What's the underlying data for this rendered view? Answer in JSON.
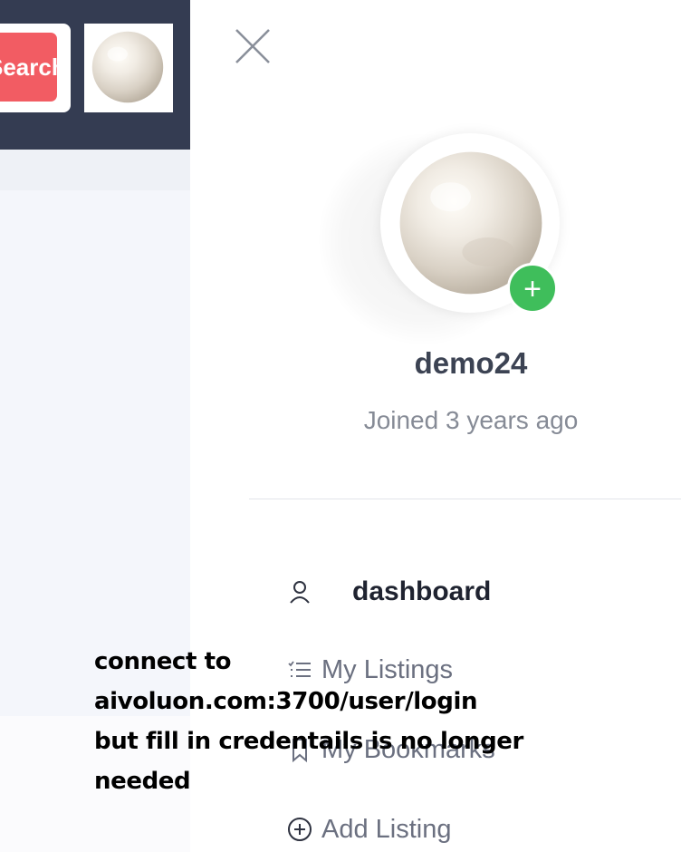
{
  "header": {
    "search_button_label": "Search"
  },
  "drawer": {
    "profile": {
      "username": "demo24",
      "joined": "Joined 3 years ago"
    },
    "menu": [
      {
        "label": "dashboard",
        "icon": "user-icon"
      },
      {
        "label": "My Listings",
        "icon": "list-icon"
      },
      {
        "label": "My Bookmarks",
        "icon": "bookmark-icon"
      },
      {
        "label": "Add Listing",
        "icon": "plus-circle-icon"
      }
    ]
  },
  "note": {
    "text": "connect to\naivoluon.com:3700/user/login\nbut fill in credentails is no longer\nneeded"
  },
  "colors": {
    "header_bg": "#343c52",
    "accent_red": "#f25c63",
    "add_green": "#3fbe5b",
    "username": "#3c4353",
    "muted_text": "#868b96"
  }
}
